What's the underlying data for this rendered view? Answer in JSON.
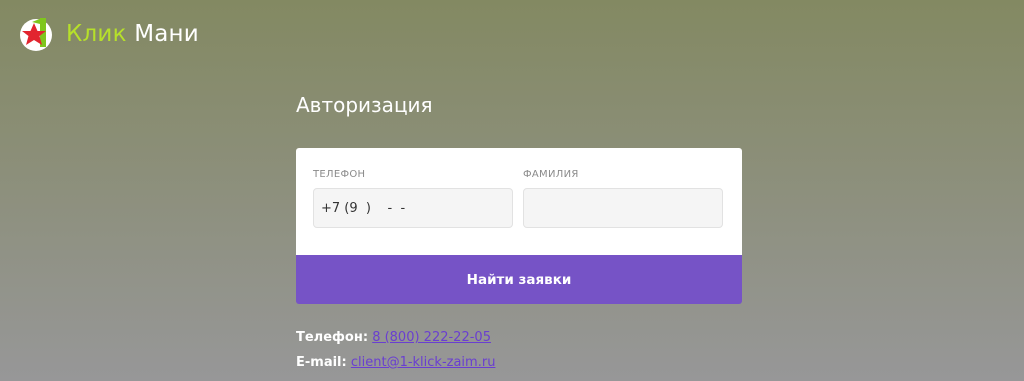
{
  "brand": {
    "name_accent": "Клик",
    "name_rest": "Мани",
    "logo_colors": {
      "ring": "#7fc61d",
      "star": "#e2252f",
      "circle": "#ffffff"
    }
  },
  "auth": {
    "title": "Авторизация",
    "phone": {
      "label": "Телефон",
      "value": "+7 (9  )    -  -"
    },
    "surname": {
      "label": "Фамилия",
      "value": ""
    },
    "submit_label": "Найти заявки"
  },
  "contacts": {
    "phone_label": "Телефон:",
    "phone_value": "8 (800) 222-22-05",
    "email_label": "E-mail:",
    "email_value": "client@1-klick-zaim.ru"
  },
  "colors": {
    "accent": "#7653c6",
    "link": "#6a3fd0",
    "brand_green": "#b6e02a"
  }
}
